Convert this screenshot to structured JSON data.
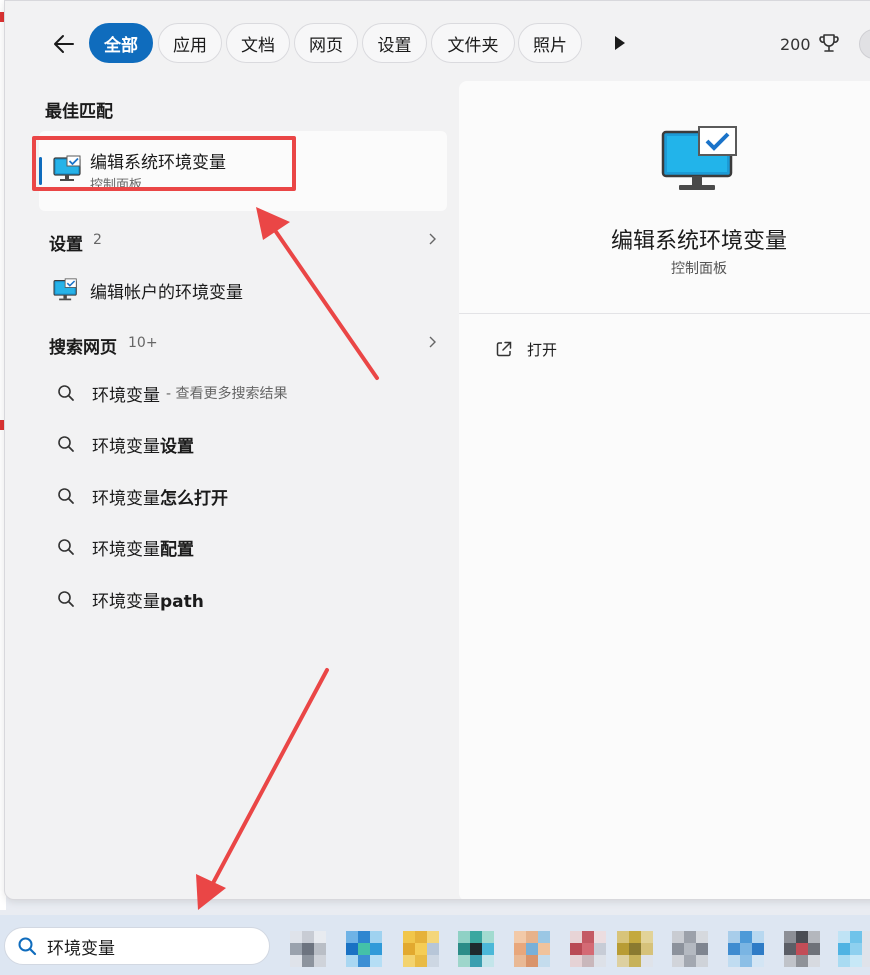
{
  "filters": {
    "items": [
      "全部",
      "应用",
      "文档",
      "网页",
      "设置",
      "文件夹",
      "照片"
    ],
    "active_index": 0
  },
  "header": {
    "score": "200"
  },
  "best_match": {
    "section_title": "最佳匹配",
    "name": "编辑系统环境变量",
    "category": "控制面板"
  },
  "settings_section": {
    "title": "设置",
    "count": "2",
    "items": [
      "编辑帐户的环境变量"
    ]
  },
  "web_section": {
    "title": "搜索网页",
    "count": "10+",
    "items": [
      {
        "prefix": "环境变量",
        "bold": "",
        "suffix": " - 查看更多搜索结果"
      },
      {
        "prefix": "环境变量",
        "bold": "设置",
        "suffix": ""
      },
      {
        "prefix": "环境变量",
        "bold": "怎么打开",
        "suffix": ""
      },
      {
        "prefix": "环境变量",
        "bold": "配置",
        "suffix": ""
      },
      {
        "prefix": "环境变量",
        "bold": "path",
        "suffix": ""
      }
    ]
  },
  "detail": {
    "title": "编辑系统环境变量",
    "subtitle": "控制面板",
    "actions": [
      "打开"
    ]
  },
  "taskbar": {
    "search_value": "环境变量"
  },
  "colors": {
    "accent": "#0f6cbd",
    "annotation_red": "#ea4646",
    "panel_bg": "#f2f2f3",
    "card_bg": "#fbfbfb"
  },
  "icons": {
    "back": "arrow-left-icon",
    "play": "play-icon",
    "trophy": "trophy-icon",
    "app": "monitor-check-icon",
    "chevron": "chevron-right-icon",
    "search": "search-icon",
    "open": "open-external-icon"
  }
}
